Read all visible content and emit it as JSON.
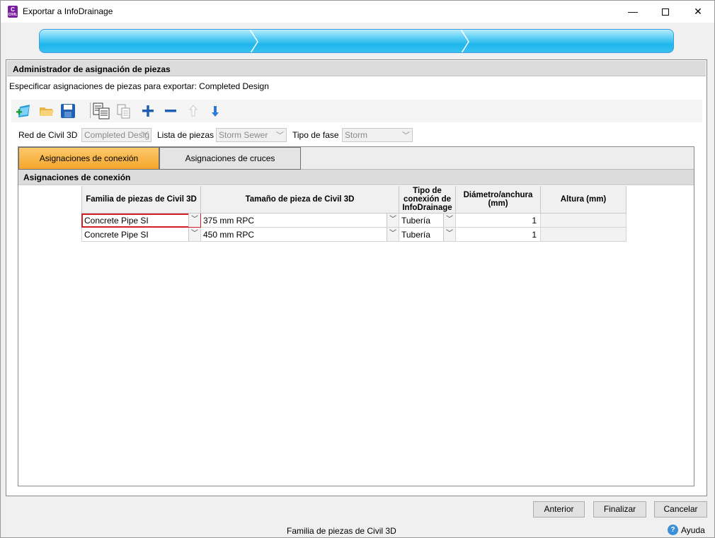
{
  "window": {
    "title": "Exportar a InfoDrainage",
    "app_icon_letter": "C",
    "app_icon_sub": "CIVIL",
    "minimize_glyph": "—",
    "close_glyph": "✕"
  },
  "progress": {
    "steps_count": 3,
    "accent": "#1fb6ec"
  },
  "panel": {
    "header": "Administrador de asignación de piezas",
    "subtitle": "Especificar asignaciones de piezas para exportar: Completed Design"
  },
  "toolbar": {
    "icons": [
      "new-assignment-icon",
      "open-folder-icon",
      "save-icon",
      "copy-mapping-icon",
      "paste-icon",
      "add-icon",
      "remove-icon",
      "move-up-icon",
      "move-down-icon"
    ]
  },
  "filters": {
    "network_label": "Red de Civil 3D",
    "network_value": "Completed Desig",
    "parts_list_label": "Lista de piezas",
    "parts_list_value": "Storm Sewer",
    "phase_label": "Tipo de fase",
    "phase_value": "Storm"
  },
  "tabs": [
    {
      "label": "Asignaciones de conexión",
      "active": true
    },
    {
      "label": "Asignaciones de cruces",
      "active": false
    }
  ],
  "grid": {
    "section_title": "Asignaciones de conexión",
    "headers": [
      "Familia de piezas de Civil 3D",
      "Tamaño de pieza de Civil 3D",
      "Tipo de conexión de InfoDrainage",
      "Diámetro/anchura (mm)",
      "Altura (mm)"
    ],
    "rows": [
      {
        "family": "Concrete Pipe SI",
        "size": "375 mm RPC",
        "type": "Tubería",
        "diameter": "1",
        "height": ""
      },
      {
        "family": "Concrete Pipe SI",
        "size": "450 mm RPC",
        "type": "Tubería",
        "diameter": "1",
        "height": ""
      }
    ],
    "selected_color": "#d21f2a"
  },
  "buttons": {
    "previous": "Anterior",
    "finish": "Finalizar",
    "cancel": "Cancelar"
  },
  "status_bar": {
    "text": "Familia de piezas de Civil 3D",
    "help_label": "Ayuda",
    "help_glyph": "?"
  },
  "dropdown_glyph": "﹀"
}
